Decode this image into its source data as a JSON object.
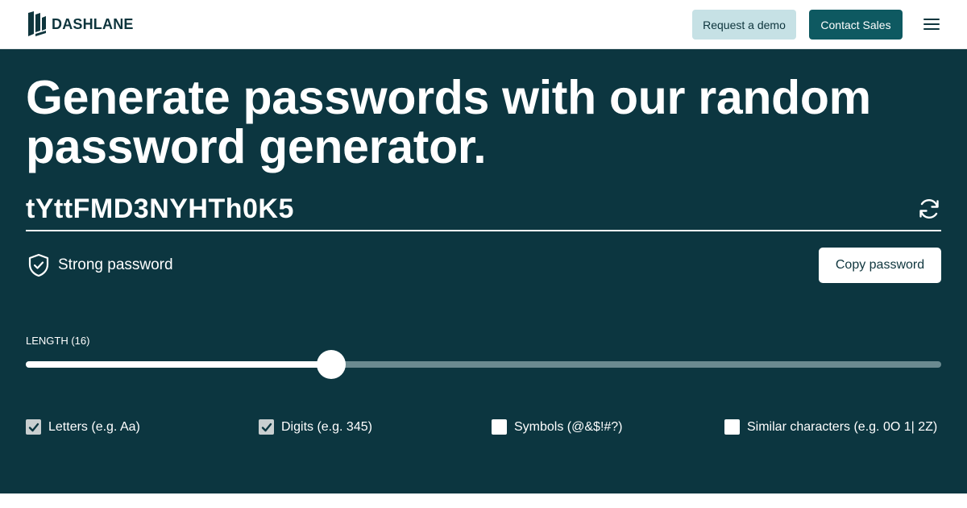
{
  "header": {
    "brand": "DASHLANE",
    "request_demo_label": "Request a demo",
    "contact_sales_label": "Contact Sales"
  },
  "hero": {
    "headline": "Generate passwords with our random password generator.",
    "password": "tYttFMD3NYHTh0K5",
    "strength_label": "Strong password",
    "copy_label": "Copy password",
    "length_label": "LENGTH (16)",
    "length_value_fraction": 0.334
  },
  "options": [
    {
      "label": "Letters (e.g. Aa)",
      "checked": true
    },
    {
      "label": "Digits (e.g. 345)",
      "checked": true
    },
    {
      "label": "Symbols (@&$!#?)",
      "checked": false
    },
    {
      "label": "Similar characters (e.g. 0O 1| 2Z)",
      "checked": false
    }
  ],
  "colors": {
    "hero_bg": "#0c3640",
    "brand_dark": "#0e353d",
    "sales_button": "#0e5961",
    "demo_button": "#c6e1e5"
  },
  "icons": {
    "logo": "dashlane-logo-icon",
    "menu": "hamburger-menu-icon",
    "refresh": "refresh-icon",
    "shield": "shield-check-icon",
    "checkmark": "checkmark-icon"
  }
}
